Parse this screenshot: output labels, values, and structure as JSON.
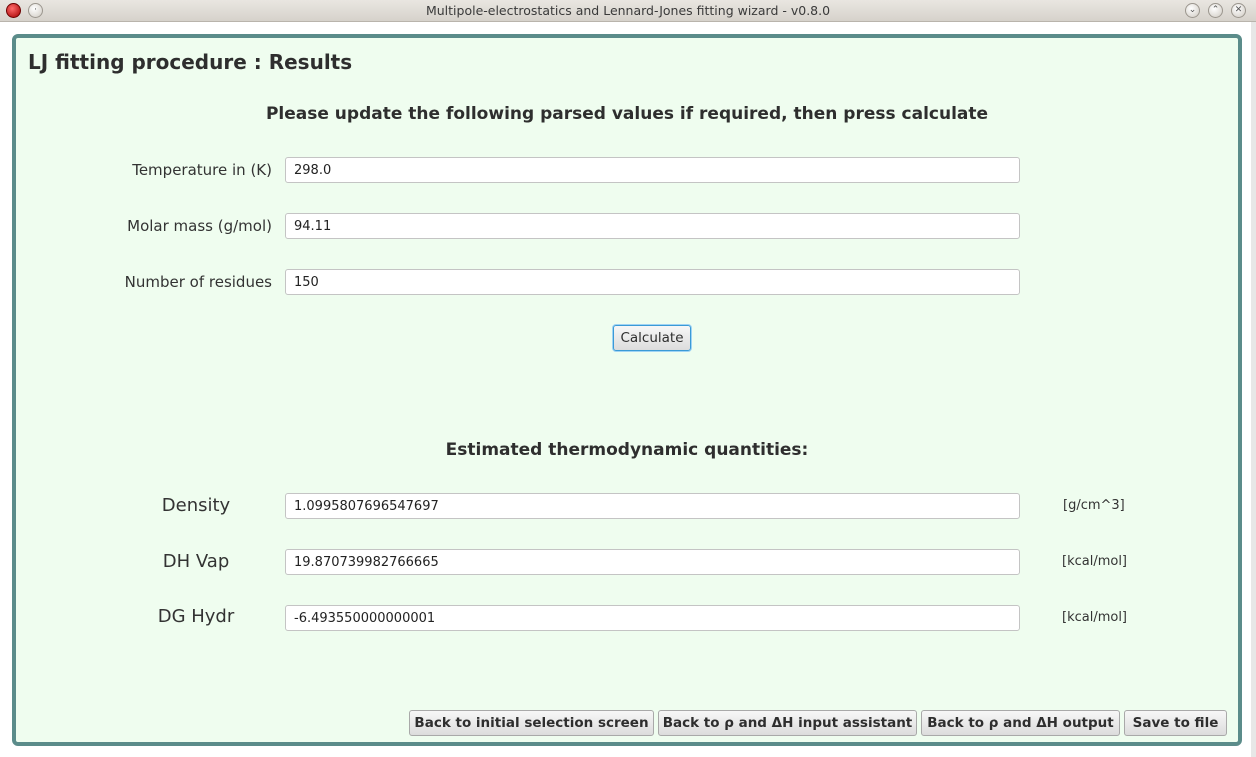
{
  "window": {
    "title": "Multipole-electrostatics and Lennard-Jones fitting wizard - v0.8.0"
  },
  "page": {
    "heading": "LJ fitting procedure : Results",
    "instructions": "Please update the following parsed values if required, then press calculate",
    "results_heading": "Estimated thermodynamic quantities:"
  },
  "inputs": {
    "temperature": {
      "label": "Temperature in (K)",
      "value": "298.0"
    },
    "molar_mass": {
      "label": "Molar mass (g/mol)",
      "value": "94.11"
    },
    "residues": {
      "label": "Number of residues",
      "value": "150"
    }
  },
  "calculate_label": "Calculate",
  "results": {
    "density": {
      "label": "Density",
      "value": "1.0995807696547697",
      "unit": "[g/cm^3]"
    },
    "dh_vap": {
      "label": "DH Vap",
      "value": "19.870739982766665",
      "unit": "[kcal/mol]"
    },
    "dg_hydr": {
      "label": "DG Hydr",
      "value": "-6.493550000000001",
      "unit": "[kcal/mol]"
    }
  },
  "buttons": {
    "back_initial": "Back to initial selection screen",
    "back_input": "Back to ρ and ΔH input assistant",
    "back_output": "Back to ρ and ΔH output",
    "save": "Save to file"
  },
  "icons": {
    "app": "app-icon",
    "menu": "window-menu-icon",
    "minimize": "minimize-icon",
    "maximize": "maximize-icon",
    "close": "close-icon"
  }
}
